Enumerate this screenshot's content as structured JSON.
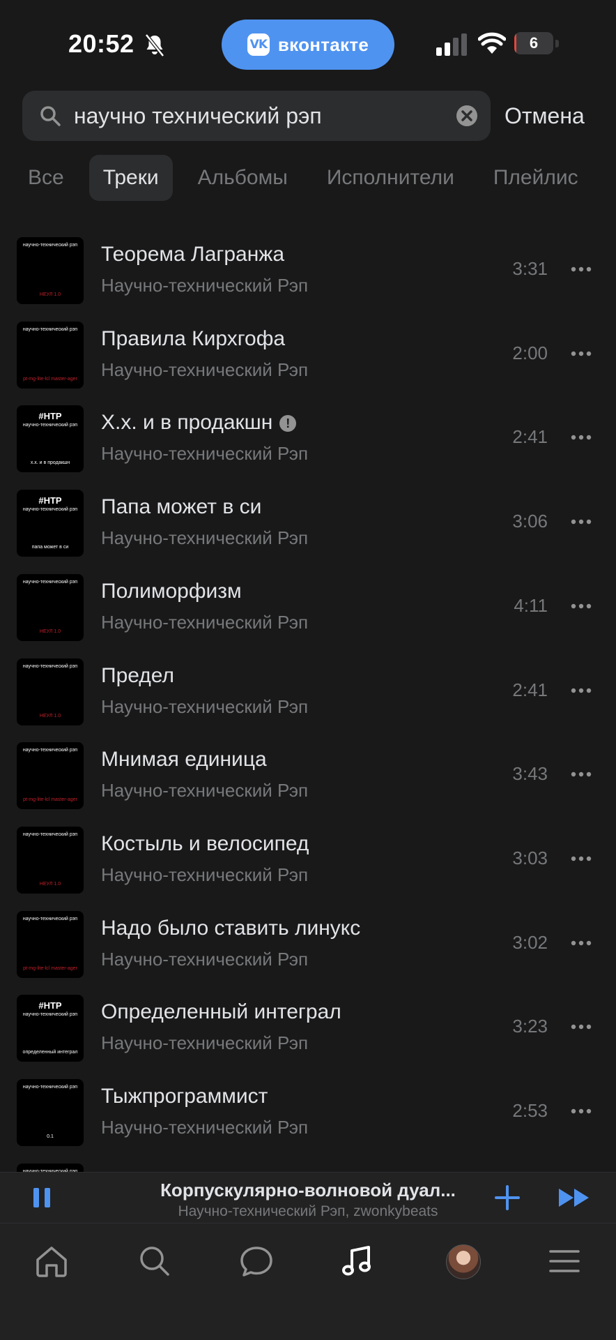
{
  "status_bar": {
    "time": "20:52",
    "app_pill": "вконтакте",
    "vk_logo_text": "VK",
    "battery_level": "6",
    "battery_fraction": 0.06,
    "icons": [
      "bell-off-icon",
      "signal-icon",
      "wifi-icon",
      "battery-icon"
    ]
  },
  "search": {
    "query": "научно технический рэп",
    "cancel_label": "Отмена"
  },
  "tabs": [
    {
      "label": "Все"
    },
    {
      "label": "Треки"
    },
    {
      "label": "Альбомы"
    },
    {
      "label": "Исполнители"
    },
    {
      "label": "Плейлис"
    }
  ],
  "active_tab": "Треки",
  "tracks": [
    {
      "title": "Теорема Лагранжа",
      "artist": "Научно-технический Рэп",
      "duration": "3:31",
      "cover_top": "научно-технический рэп",
      "cover_bottom": "НЕУЛ 1.0"
    },
    {
      "title": "Правила Кирхгофа",
      "artist": "Научно-технический Рэп",
      "duration": "2:00",
      "cover_top": "научно-технический рэп",
      "cover_bottom": "pt-mg-lite-lcl master-ager"
    },
    {
      "title": "Х.х. и в продакшн",
      "artist": "Научно-технический Рэп",
      "duration": "2:41",
      "cover_tag": "#НТР",
      "cover_top": "научно-технический рэп",
      "cover_bottom": "х.х. и в продакшн",
      "explicit": true
    },
    {
      "title": "Папа может в си",
      "artist": "Научно-технический Рэп",
      "duration": "3:06",
      "cover_tag": "#НТР",
      "cover_top": "научно-технический рэп",
      "cover_bottom": "папа может в си"
    },
    {
      "title": "Полиморфизм",
      "artist": "Научно-технический Рэп",
      "duration": "4:11",
      "cover_top": "научно-технический рэп",
      "cover_bottom": "НЕУЛ 1.0"
    },
    {
      "title": "Предел",
      "artist": "Научно-технический Рэп",
      "duration": "2:41",
      "cover_top": "научно-технический рэп",
      "cover_bottom": "НЕУЛ 1.0"
    },
    {
      "title": "Мнимая единица",
      "artist": "Научно-технический Рэп",
      "duration": "3:43",
      "cover_top": "научно-технический рэп",
      "cover_bottom": "pt-mg-lite-lcl master-ager"
    },
    {
      "title": "Костыль и велосипед",
      "artist": "Научно-технический Рэп",
      "duration": "3:03",
      "cover_top": "научно-технический рэп",
      "cover_bottom": "НЕУЛ 1.0"
    },
    {
      "title": "Надо было ставить линукс",
      "artist": "Научно-технический Рэп",
      "duration": "3:02",
      "cover_top": "научно-технический рэп",
      "cover_bottom": "pt-mg-lite-lcl master-ager"
    },
    {
      "title": "Определенный интеграл",
      "artist": "Научно-технический Рэп",
      "duration": "3:23",
      "cover_tag": "#НТР",
      "cover_top": "научно-технический рэп",
      "cover_bottom": "определенный интеграл"
    },
    {
      "title": "Тыжпрограммист",
      "artist": "Научно-технический Рэп",
      "duration": "2:53",
      "cover_top": "научно-технический рэп",
      "cover_bottom": "0.1"
    },
    {
      "title": "",
      "artist": "",
      "duration": "",
      "cover_top": "научно-технический рэп",
      "cover_bottom": ""
    }
  ],
  "now_playing": {
    "title": "Корпускулярно-волновой дуал...",
    "artist": "Научно-технический Рэп, zwonkybeats"
  },
  "bottom_nav": {
    "items": [
      "home-icon",
      "search-icon",
      "messages-icon",
      "music-icon",
      "avatar",
      "menu-icon"
    ],
    "active": "music-icon"
  },
  "colors": {
    "background": "#19191a",
    "accent": "#4f93f0",
    "text_primary": "#e1e3e6",
    "text_secondary": "#76787a"
  }
}
